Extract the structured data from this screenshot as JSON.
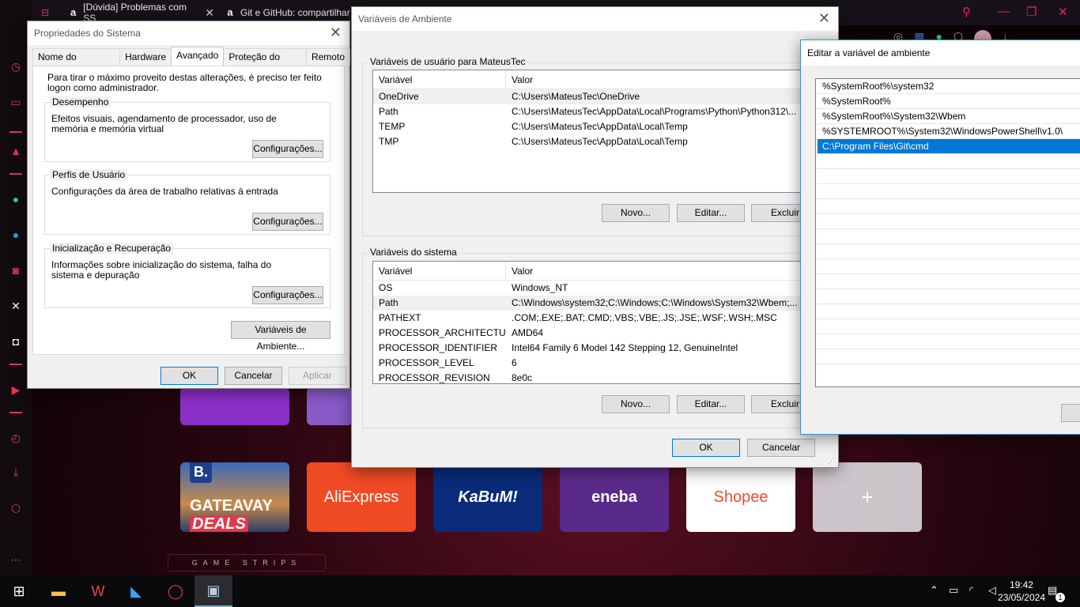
{
  "browser": {
    "tabs": [
      {
        "label": "[Dúvida] Problemas com SS"
      },
      {
        "label": "Git e GitHub: compartilhar"
      }
    ]
  },
  "speed_dial": {
    "tiles": [
      "GATEAVAY",
      "DEALS",
      "AliExpress",
      "KaBuM!",
      "eneba",
      "Shopee",
      "+"
    ],
    "strip_label": "GAME STRIPS"
  },
  "sysprops": {
    "title": "Propriedades do Sistema",
    "tabs": [
      "Nome do Computador",
      "Hardware",
      "Avançado",
      "Proteção do Sistema",
      "Remoto"
    ],
    "intro": "Para tirar o máximo proveito destas alterações, é preciso ter feito logon como administrador.",
    "groups": [
      {
        "label": "Desempenho",
        "text": "Efeitos visuais, agendamento de processador, uso de memória e memória virtual",
        "button": "Configurações..."
      },
      {
        "label": "Perfis de Usuário",
        "text": "Configurações da área de trabalho relativas à entrada",
        "button": "Configurações..."
      },
      {
        "label": "Inicialização e Recuperação",
        "text": "Informações sobre inicialização do sistema, falha do sistema e depuração",
        "button": "Configurações..."
      }
    ],
    "env_button": "Variáveis de Ambiente...",
    "ok": "OK",
    "cancel": "Cancelar",
    "apply": "Aplicar"
  },
  "envvars": {
    "title": "Variáveis de Ambiente",
    "user_label": "Variáveis de usuário para MateusTec",
    "col_var": "Variável",
    "col_val": "Valor",
    "user_rows": [
      {
        "name": "OneDrive",
        "value": "C:\\Users\\MateusTec\\OneDrive"
      },
      {
        "name": "Path",
        "value": "C:\\Users\\MateusTec\\AppData\\Local\\Programs\\Python\\Python312\\..."
      },
      {
        "name": "TEMP",
        "value": "C:\\Users\\MateusTec\\AppData\\Local\\Temp"
      },
      {
        "name": "TMP",
        "value": "C:\\Users\\MateusTec\\AppData\\Local\\Temp"
      }
    ],
    "system_label": "Variáveis do sistema",
    "system_rows": [
      {
        "name": "OS",
        "value": "Windows_NT"
      },
      {
        "name": "Path",
        "value": "C:\\Windows\\system32;C:\\Windows;C:\\Windows\\System32\\Wbem;..."
      },
      {
        "name": "PATHEXT",
        "value": ".COM;.EXE;.BAT;.CMD;.VBS;.VBE;.JS;.JSE;.WSF;.WSH;.MSC"
      },
      {
        "name": "PROCESSOR_ARCHITECTURE",
        "value": "AMD64"
      },
      {
        "name": "PROCESSOR_IDENTIFIER",
        "value": "Intel64 Family 6 Model 142 Stepping 12, GenuineIntel"
      },
      {
        "name": "PROCESSOR_LEVEL",
        "value": "6"
      },
      {
        "name": "PROCESSOR_REVISION",
        "value": "8e0c"
      }
    ],
    "new": "Novo...",
    "edit": "Editar...",
    "delete": "Excluir",
    "ok": "OK",
    "cancel": "Cancelar"
  },
  "editvar": {
    "title": "Editar a variável de ambiente",
    "entries": [
      "%SystemRoot%\\system32",
      "%SystemRoot%",
      "%SystemRoot%\\System32\\Wbem",
      "%SYSTEMROOT%\\System32\\WindowsPowerShell\\v1.0\\",
      "C:\\Program Files\\Git\\cmd"
    ]
  },
  "taskbar": {
    "time": "19:42",
    "date": "23/05/2024",
    "notif_count": "1"
  }
}
